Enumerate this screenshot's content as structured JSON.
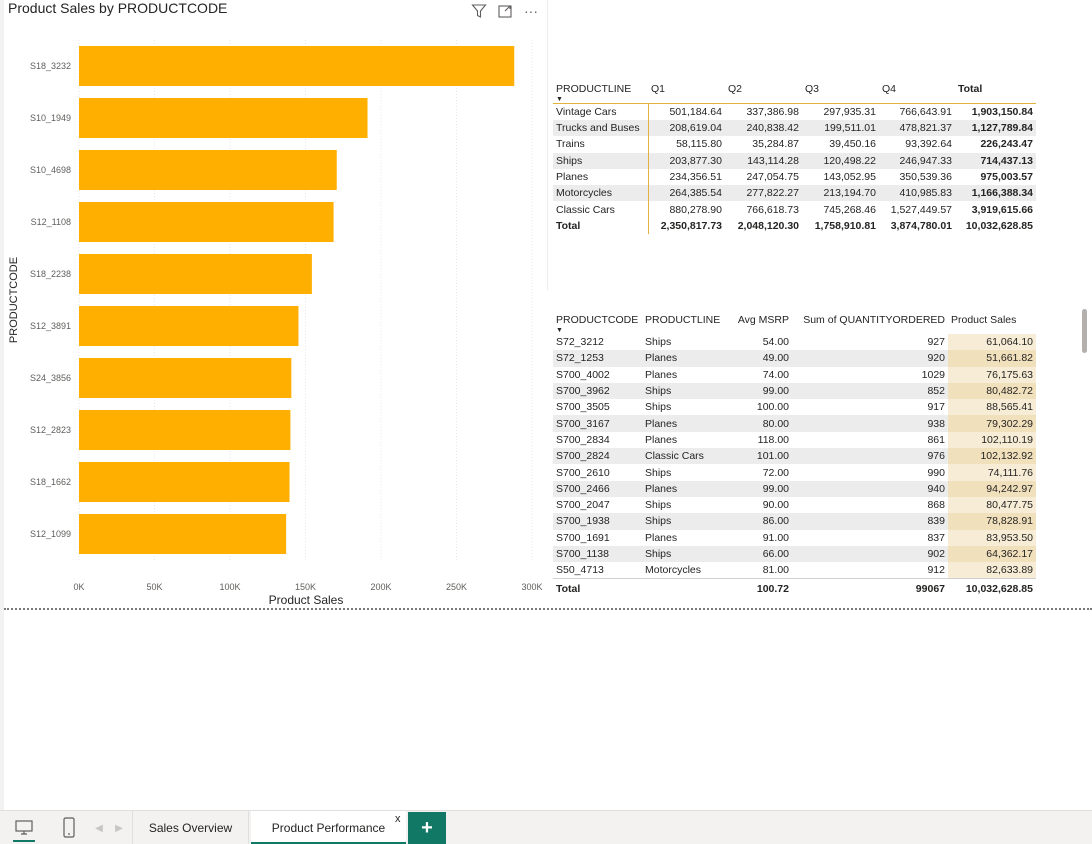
{
  "visual": {
    "title": "Product Sales by PRODUCTCODE",
    "icons": [
      "filter-icon",
      "focus-mode-icon",
      "more-options-icon"
    ],
    "more_glyph": "···"
  },
  "chart_data": {
    "type": "bar",
    "orientation": "horizontal",
    "title": "Product Sales by PRODUCTCODE",
    "xlabel": "Product Sales",
    "ylabel": "PRODUCTCODE",
    "categories": [
      "S18_3232",
      "S10_1949",
      "S10_4698",
      "S12_1108",
      "S18_2238",
      "S12_3891",
      "S24_3856",
      "S12_2823",
      "S18_1662",
      "S12_1099"
    ],
    "values": [
      288245,
      191073,
      170687,
      168585,
      154234,
      145332,
      140626,
      140006,
      139421,
      137174
    ],
    "xlim": [
      0,
      300000
    ],
    "xticks": [
      0,
      50000,
      100000,
      150000,
      200000,
      250000,
      300000
    ],
    "xtick_labels": [
      "0K",
      "50K",
      "100K",
      "150K",
      "200K",
      "250K",
      "300K"
    ],
    "grid": "vertical dotted",
    "bar_color": "#FFAF00"
  },
  "matrix1": {
    "headers": [
      "PRODUCTLINE",
      "Q1",
      "Q2",
      "Q3",
      "Q4",
      "Total"
    ],
    "rows": [
      [
        "Vintage Cars",
        "501,184.64",
        "337,386.98",
        "297,935.31",
        "766,643.91",
        "1,903,150.84"
      ],
      [
        "Trucks and Buses",
        "208,619.04",
        "240,838.42",
        "199,511.01",
        "478,821.37",
        "1,127,789.84"
      ],
      [
        "Trains",
        "58,115.80",
        "35,284.87",
        "39,450.16",
        "93,392.64",
        "226,243.47"
      ],
      [
        "Ships",
        "203,877.30",
        "143,114.28",
        "120,498.22",
        "246,947.33",
        "714,437.13"
      ],
      [
        "Planes",
        "234,356.51",
        "247,054.75",
        "143,052.95",
        "350,539.36",
        "975,003.57"
      ],
      [
        "Motorcycles",
        "264,385.54",
        "277,822.27",
        "213,194.70",
        "410,985.83",
        "1,166,388.34"
      ],
      [
        "Classic Cars",
        "880,278.90",
        "766,618.73",
        "745,268.46",
        "1,527,449.57",
        "3,919,615.66"
      ]
    ],
    "total": [
      "Total",
      "2,350,817.73",
      "2,048,120.30",
      "1,758,910.81",
      "3,874,780.01",
      "10,032,628.85"
    ]
  },
  "matrix2": {
    "headers": [
      "PRODUCTCODE",
      "PRODUCTLINE",
      "Avg MSRP",
      "Sum of QUANTITYORDERED",
      "Product Sales"
    ],
    "rows": [
      [
        "S72_3212",
        "Ships",
        "54.00",
        "927",
        "61,064.10"
      ],
      [
        "S72_1253",
        "Planes",
        "49.00",
        "920",
        "51,661.82"
      ],
      [
        "S700_4002",
        "Planes",
        "74.00",
        "1029",
        "76,175.63"
      ],
      [
        "S700_3962",
        "Ships",
        "99.00",
        "852",
        "80,482.72"
      ],
      [
        "S700_3505",
        "Ships",
        "100.00",
        "917",
        "88,565.41"
      ],
      [
        "S700_3167",
        "Planes",
        "80.00",
        "938",
        "79,302.29"
      ],
      [
        "S700_2834",
        "Planes",
        "118.00",
        "861",
        "102,110.19"
      ],
      [
        "S700_2824",
        "Classic Cars",
        "101.00",
        "976",
        "102,132.92"
      ],
      [
        "S700_2610",
        "Ships",
        "72.00",
        "990",
        "74,111.76"
      ],
      [
        "S700_2466",
        "Planes",
        "99.00",
        "940",
        "94,242.97"
      ],
      [
        "S700_2047",
        "Ships",
        "90.00",
        "868",
        "80,477.75"
      ],
      [
        "S700_1938",
        "Ships",
        "86.00",
        "839",
        "78,828.91"
      ],
      [
        "S700_1691",
        "Planes",
        "91.00",
        "837",
        "83,953.50"
      ],
      [
        "S700_1138",
        "Ships",
        "66.00",
        "902",
        "64,362.17"
      ],
      [
        "S50_4713",
        "Motorcycles",
        "81.00",
        "912",
        "82,633.89"
      ]
    ],
    "total": [
      "Total",
      "",
      "100.72",
      "99067",
      "10,032,628.85"
    ]
  },
  "tabs": {
    "sales_overview": "Sales Overview",
    "product_performance": "Product Performance",
    "close_glyph": "x",
    "add_glyph": "+"
  },
  "colors": {
    "bar": "#FFAF00",
    "accent": "#117865",
    "matrix_border": "#E2B23A",
    "sales_highlight": "#F7ECD5"
  }
}
